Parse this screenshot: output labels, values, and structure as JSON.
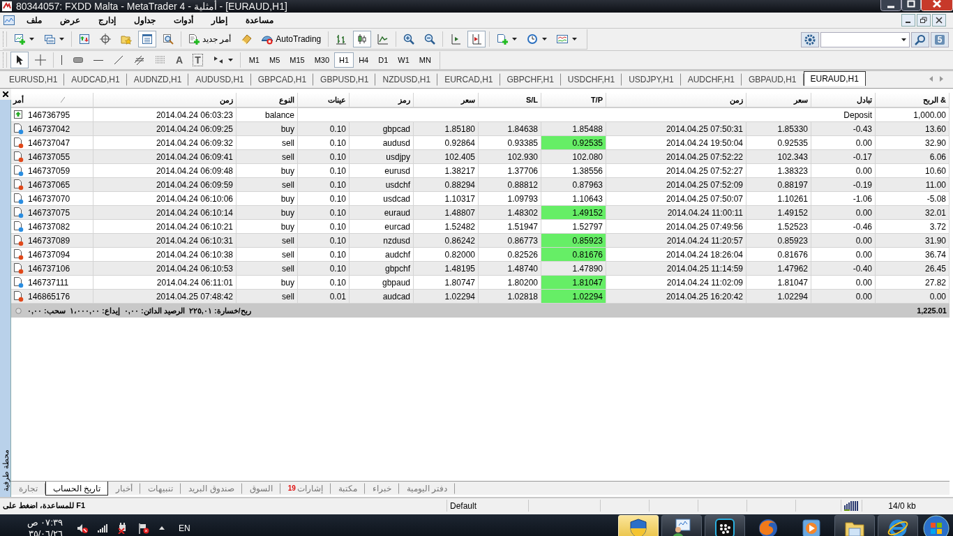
{
  "window": {
    "title": "80344057: FXDD Malta - MetaTrader 4 - أمثلية - [EURAUD,H1]"
  },
  "menu": [
    "مساعدة",
    "إطار",
    "أدوات",
    "جداول",
    "إدارج",
    "عرض",
    "ملف"
  ],
  "toolbar": {
    "groups": [
      {
        "buttons": [
          {
            "kind": "new-chart",
            "pressed": false
          },
          {
            "kind": "profiles",
            "pressed": false
          }
        ]
      },
      {
        "buttons": [
          {
            "kind": "market-watch",
            "pressed": false
          },
          {
            "kind": "navigator",
            "pressed": false
          },
          {
            "kind": "favorites",
            "pressed": false
          },
          {
            "kind": "terminal",
            "pressed": true
          },
          {
            "kind": "tester",
            "pressed": false
          }
        ]
      },
      {
        "buttons": [
          {
            "kind": "new-order",
            "label": "أمر جديد",
            "pressed": false
          },
          {
            "kind": "editor",
            "pressed": false
          },
          {
            "kind": "autotrading",
            "label": "AutoTrading",
            "pressed": false
          }
        ]
      },
      {
        "buttons": [
          {
            "kind": "bar-chart",
            "pressed": false
          },
          {
            "kind": "candles",
            "pressed": true
          },
          {
            "kind": "line-chart",
            "pressed": false
          }
        ]
      },
      {
        "buttons": [
          {
            "kind": "zoom-in",
            "pressed": false
          },
          {
            "kind": "zoom-out",
            "pressed": false
          }
        ]
      },
      {
        "buttons": [
          {
            "kind": "chart-shift",
            "pressed": false
          },
          {
            "kind": "autoscroll",
            "pressed": true
          }
        ]
      },
      {
        "buttons": [
          {
            "kind": "templates",
            "pressed": false
          },
          {
            "kind": "periods",
            "pressed": false
          },
          {
            "kind": "indicators",
            "pressed": false
          }
        ]
      }
    ],
    "messages": "5"
  },
  "tools": {
    "groups": [
      {
        "buttons": [
          {
            "kind": "cursor",
            "pressed": true
          },
          {
            "kind": "crosshair",
            "pressed": false
          }
        ]
      },
      {
        "buttons": [
          {
            "kind": "vline",
            "pressed": false
          },
          {
            "kind": "rectangle",
            "pressed": false
          },
          {
            "kind": "hline",
            "pressed": false
          },
          {
            "kind": "trendline",
            "pressed": false
          },
          {
            "kind": "channel",
            "pressed": false
          },
          {
            "kind": "grid",
            "pressed": false
          },
          {
            "kind": "text",
            "glyph": "A",
            "pressed": false
          },
          {
            "kind": "label",
            "glyph": "T",
            "pressed": false
          },
          {
            "kind": "arrows",
            "pressed": false
          }
        ]
      }
    ]
  },
  "timeframes": [
    {
      "label": "M1",
      "selected": false
    },
    {
      "label": "M5",
      "selected": false
    },
    {
      "label": "M15",
      "selected": false
    },
    {
      "label": "M30",
      "selected": false
    },
    {
      "label": "H1",
      "selected": true
    },
    {
      "label": "H4",
      "selected": false
    },
    {
      "label": "D1",
      "selected": false
    },
    {
      "label": "W1",
      "selected": false
    },
    {
      "label": "MN",
      "selected": false
    }
  ],
  "chart_tabs": [
    {
      "label": "EURUSD,H1",
      "selected": false
    },
    {
      "label": "AUDCAD,H1",
      "selected": false
    },
    {
      "label": "AUDNZD,H1",
      "selected": false
    },
    {
      "label": "AUDUSD,H1",
      "selected": false
    },
    {
      "label": "GBPCAD,H1",
      "selected": false
    },
    {
      "label": "GBPUSD,H1",
      "selected": false
    },
    {
      "label": "NZDUSD,H1",
      "selected": false
    },
    {
      "label": "EURCAD,H1",
      "selected": false
    },
    {
      "label": "GBPCHF,H1",
      "selected": false
    },
    {
      "label": "USDCHF,H1",
      "selected": false
    },
    {
      "label": "USDJPY,H1",
      "selected": false
    },
    {
      "label": "AUDCHF,H1",
      "selected": false
    },
    {
      "label": "GBPAUD,H1",
      "selected": false
    },
    {
      "label": "EURAUD,H1",
      "selected": true
    }
  ],
  "terminal": {
    "title": "محطة طرفية",
    "columns": [
      "أمر",
      "زمن",
      "النوع",
      "عينات",
      "رمز",
      "سعر",
      "S/L",
      "T/P",
      "زمن",
      "سعر",
      "تبادل",
      "الربح &"
    ],
    "rows": [
      {
        "kind": "balance",
        "cells": [
          "146736795",
          "2014.04.24 06:03:23",
          "balance",
          "",
          "",
          "",
          "",
          "",
          "",
          "",
          "Deposit",
          "1,000.00"
        ]
      },
      {
        "kind": "buy",
        "tp_reached": false,
        "cells": [
          "146737042",
          "2014.04.24 06:09:25",
          "buy",
          "0.10",
          "gbpcad",
          "1.85180",
          "1.84638",
          "1.85488",
          "2014.04.25 07:50:31",
          "1.85330",
          "-0.43",
          "13.60"
        ]
      },
      {
        "kind": "sell",
        "tp_reached": true,
        "cells": [
          "146737047",
          "2014.04.24 06:09:32",
          "sell",
          "0.10",
          "audusd",
          "0.92864",
          "0.93385",
          "0.92535",
          "2014.04.24 19:50:04",
          "0.92535",
          "0.00",
          "32.90"
        ]
      },
      {
        "kind": "sell",
        "tp_reached": false,
        "cells": [
          "146737055",
          "2014.04.24 06:09:41",
          "sell",
          "0.10",
          "usdjpy",
          "102.405",
          "102.930",
          "102.080",
          "2014.04.25 07:52:22",
          "102.343",
          "-0.17",
          "6.06"
        ]
      },
      {
        "kind": "buy",
        "tp_reached": false,
        "cells": [
          "146737059",
          "2014.04.24 06:09:48",
          "buy",
          "0.10",
          "eurusd",
          "1.38217",
          "1.37706",
          "1.38556",
          "2014.04.25 07:52:27",
          "1.38323",
          "0.00",
          "10.60"
        ]
      },
      {
        "kind": "sell",
        "tp_reached": false,
        "cells": [
          "146737065",
          "2014.04.24 06:09:59",
          "sell",
          "0.10",
          "usdchf",
          "0.88294",
          "0.88812",
          "0.87963",
          "2014.04.25 07:52:09",
          "0.88197",
          "-0.19",
          "11.00"
        ]
      },
      {
        "kind": "buy",
        "tp_reached": false,
        "cells": [
          "146737070",
          "2014.04.24 06:10:06",
          "buy",
          "0.10",
          "usdcad",
          "1.10317",
          "1.09793",
          "1.10643",
          "2014.04.25 07:50:07",
          "1.10261",
          "-1.06",
          "-5.08"
        ]
      },
      {
        "kind": "buy",
        "tp_reached": true,
        "cells": [
          "146737075",
          "2014.04.24 06:10:14",
          "buy",
          "0.10",
          "euraud",
          "1.48807",
          "1.48302",
          "1.49152",
          "2014.04.24 11:00:11",
          "1.49152",
          "0.00",
          "32.01"
        ]
      },
      {
        "kind": "buy",
        "tp_reached": false,
        "cells": [
          "146737082",
          "2014.04.24 06:10:21",
          "buy",
          "0.10",
          "eurcad",
          "1.52482",
          "1.51947",
          "1.52797",
          "2014.04.25 07:49:56",
          "1.52523",
          "-0.46",
          "3.72"
        ]
      },
      {
        "kind": "sell",
        "tp_reached": true,
        "cells": [
          "146737089",
          "2014.04.24 06:10:31",
          "sell",
          "0.10",
          "nzdusd",
          "0.86242",
          "0.86773",
          "0.85923",
          "2014.04.24 11:20:57",
          "0.85923",
          "0.00",
          "31.90"
        ]
      },
      {
        "kind": "sell",
        "tp_reached": true,
        "cells": [
          "146737094",
          "2014.04.24 06:10:38",
          "sell",
          "0.10",
          "audchf",
          "0.82000",
          "0.82526",
          "0.81676",
          "2014.04.24 18:26:04",
          "0.81676",
          "0.00",
          "36.74"
        ]
      },
      {
        "kind": "sell",
        "tp_reached": false,
        "cells": [
          "146737106",
          "2014.04.24 06:10:53",
          "sell",
          "0.10",
          "gbpchf",
          "1.48195",
          "1.48740",
          "1.47890",
          "2014.04.25 11:14:59",
          "1.47962",
          "-0.40",
          "26.45"
        ]
      },
      {
        "kind": "buy",
        "tp_reached": true,
        "cells": [
          "146737111",
          "2014.04.24 06:11:01",
          "buy",
          "0.10",
          "gbpaud",
          "1.80747",
          "1.80200",
          "1.81047",
          "2014.04.24 11:02:09",
          "1.81047",
          "0.00",
          "27.82"
        ]
      },
      {
        "kind": "sell",
        "tp_reached": true,
        "cells": [
          "146865176",
          "2014.04.25 07:48:42",
          "sell",
          "0.01",
          "audcad",
          "1.02294",
          "1.02818",
          "1.02294",
          "2014.04.25 16:20:42",
          "1.02294",
          "0.00",
          "0.00"
        ]
      }
    ],
    "summary": {
      "text": "ربح/خسارة: ٢٢٥,٠١  الرصيد الدائن: ٠,٠٠  إيداع: ١،٠٠٠,٠٠  سحب: ٠,٠٠",
      "total": "1,225.01"
    },
    "tabs": [
      {
        "label": "دفتر اليومية",
        "selected": false
      },
      {
        "label": "خبراء",
        "selected": false
      },
      {
        "label": "مكتبة",
        "selected": false
      },
      {
        "label": "إشارات",
        "badge": "19",
        "selected": false
      },
      {
        "label": "السوق",
        "selected": false
      },
      {
        "label": "صندوق البريد",
        "selected": false
      },
      {
        "label": "تنبيهات",
        "selected": false
      },
      {
        "label": "أخبار",
        "selected": false
      },
      {
        "label": "تاريخ الحساب",
        "selected": true
      },
      {
        "label": "تجارة",
        "selected": false
      }
    ]
  },
  "status_bar": {
    "help": "F1 للمساعدة، اضغط على",
    "profile": "Default",
    "traffic": "14/0 kb"
  },
  "taskbar": {
    "time": "٠٧:٣٩ ص",
    "date": "٣٥/٠٦/٢٦",
    "language": "EN",
    "apps": [
      {
        "kind": "shield",
        "running": true,
        "selected": true
      },
      {
        "kind": "people",
        "running": true,
        "selected": false
      },
      {
        "kind": "dots",
        "running": true,
        "selected": false
      },
      {
        "kind": "fox",
        "running": false,
        "selected": false
      },
      {
        "kind": "player",
        "running": false,
        "selected": false
      },
      {
        "kind": "folder",
        "running": true,
        "selected": false
      },
      {
        "kind": "ie",
        "running": true,
        "selected": false
      }
    ]
  }
}
